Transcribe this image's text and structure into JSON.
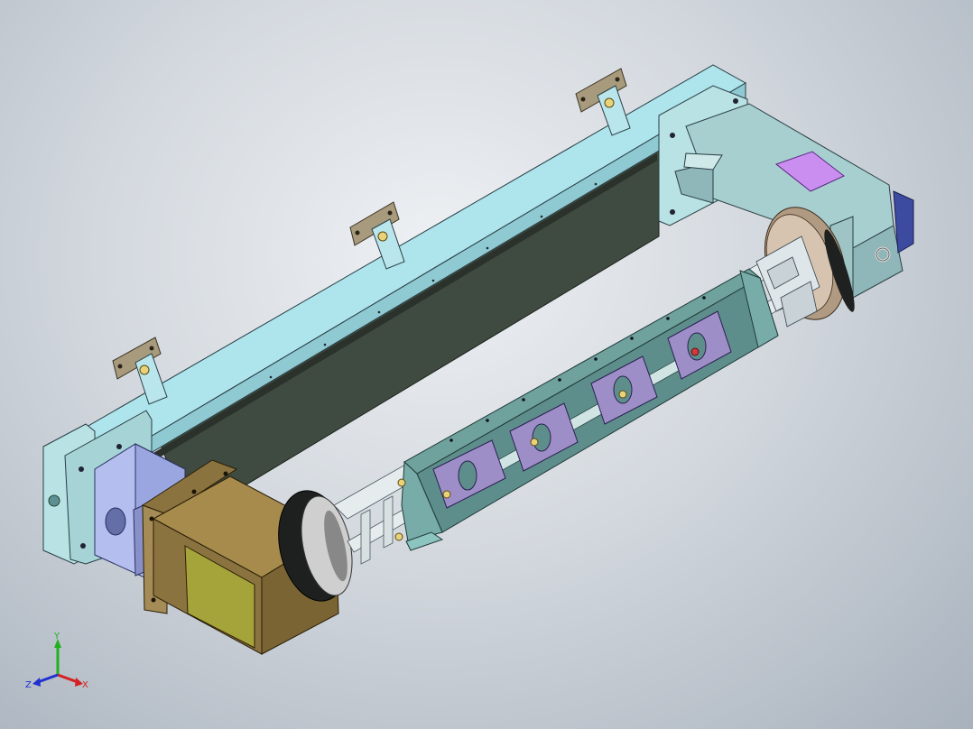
{
  "triad": {
    "x_label": "X",
    "y_label": "Y",
    "z_label": "Z",
    "x_color": "#d42020",
    "y_color": "#20b020",
    "z_color": "#2030d0"
  },
  "colors": {
    "beam_top": "#aee4ec",
    "beam_side": "#3f4a40",
    "plate": "#b8e2e4",
    "gearbox": "#a7cfcf",
    "motor_brown": "#8b7340",
    "motor_face": "#a5a43a",
    "blue_block": "#b4bfef",
    "purple_tag": "#c98ef0",
    "rail_green": "#6fa19d",
    "slider_purple": "#9e8ec8",
    "bracket": "#a89a7c"
  },
  "icons": [
    "eye-bolt-icon",
    "triad-axis-icon"
  ]
}
